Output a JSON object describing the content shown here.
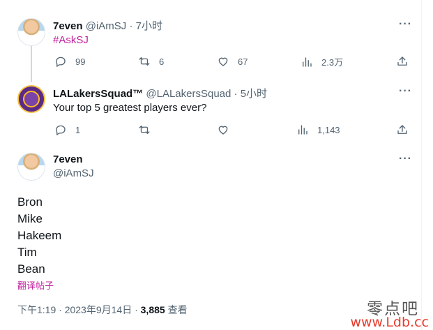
{
  "tweet1": {
    "name": "7even",
    "handle": "@iAmSJ",
    "time": "7小时",
    "text": "#AskSJ",
    "replies": "99",
    "retweets": "6",
    "likes": "67",
    "views": "2.3万"
  },
  "tweet2": {
    "name": "LALakersSquad™",
    "handle": "@LALakersSquad",
    "time": "5小时",
    "text": "Your top 5 greatest players ever?",
    "replies": "1",
    "retweets": "",
    "likes": "",
    "views": "1,143"
  },
  "main_tweet": {
    "name": "7even",
    "handle": "@iAmSJ",
    "lines": [
      "Bron",
      "Mike",
      "Hakeem",
      "Tim",
      "Bean"
    ],
    "translate_label": "翻译帖子",
    "timestamp": "下午1:19 · 2023年9月14日 · ",
    "views_count": "3,885",
    "views_label": " 查看"
  },
  "more_glyph": "···",
  "separator": " · ",
  "watermark": {
    "top": "零点吧",
    "bottom": "www.Ldb.cc"
  },
  "colors": {
    "accent_hashtag": "#c01f9f",
    "secondary_text": "#536471",
    "primary_text": "#0f1419",
    "thread_line": "#cfd9de"
  },
  "icons": {
    "reply": "reply-icon",
    "retweet": "retweet-icon",
    "like": "heart-icon",
    "views": "views-icon",
    "share": "share-icon",
    "more": "more-icon"
  }
}
